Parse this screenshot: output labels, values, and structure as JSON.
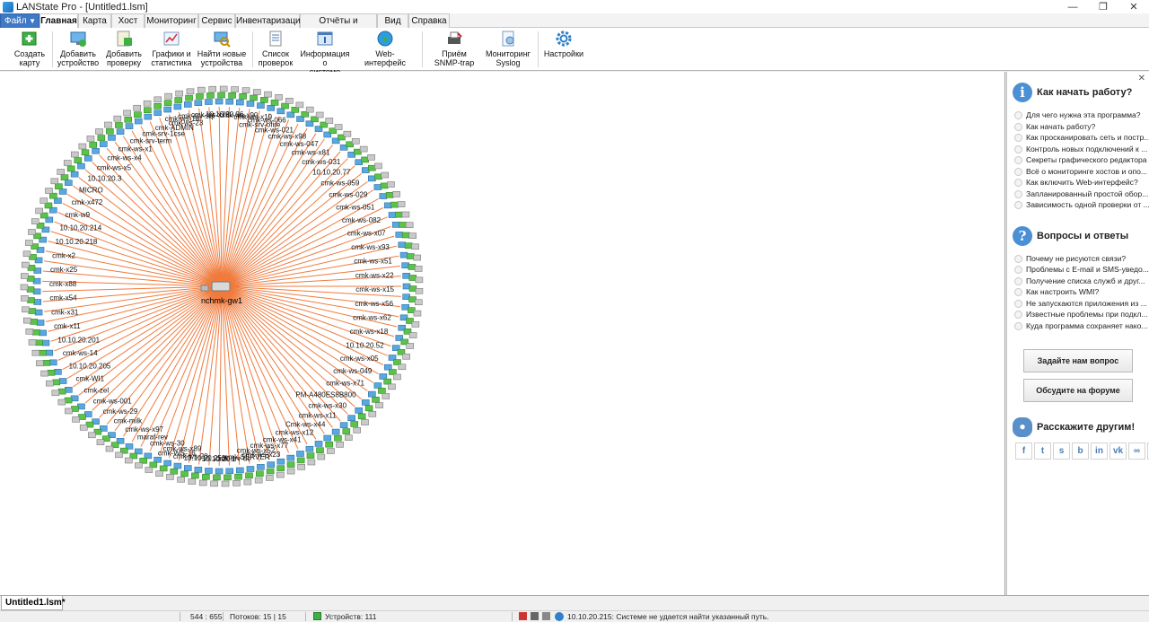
{
  "window": {
    "title": "LANState Pro - [Untitled1.lsm]"
  },
  "menu": {
    "file_label": "Файл",
    "tabs": [
      "Главная",
      "Карта",
      "Хост",
      "Мониторинг",
      "Сервис",
      "Инвентаризация",
      "Отчёты и журналы",
      "Вид",
      "Справка"
    ]
  },
  "ribbon": {
    "create_map": "Создать\nкарту",
    "add_device": "Добавить\nустройство",
    "add_check": "Добавить\nпроверку",
    "graphs": "Графики и\nстатистика",
    "find_devices": "Найти новые\nустройства",
    "check_list": "Список\nпроверок",
    "system_info": "Информация о\nсистеме",
    "web": "Web-интерфейс",
    "snmp": "Приём\nSNMP-trap",
    "syslog": "Мониторинг\nSyslog",
    "settings": "Настройки"
  },
  "map": {
    "center_label": "nchmk-gw1",
    "host_labels": [
      "cmk-ws-23",
      "cmk-ws-18",
      "cmk-srv-sql",
      "cmk-ws-x78",
      "10.10.20.96",
      "cmk-ws-x90",
      "cmk-ws-x19",
      "cmk-ws-066",
      "cmk-srv-ofire",
      "cmk-ws-021",
      "cmk-ws-x98",
      "cmk-ws-047",
      "cmk-ws-x81",
      "cmk-ws-031",
      "10.10.20.77",
      "cmk-ws-059",
      "cmk-ws-029",
      "cmk-ws-051",
      "cmk-ws-082",
      "cmk-ws-x07",
      "cmk-ws-x93",
      "cmk-ws-x51",
      "cmk-ws-x22",
      "cmk-ws-x15",
      "cmk-ws-x56",
      "cmk-ws-x62",
      "cmk-ws-x18",
      "10.10.20.52",
      "cmk-ws-x05",
      "cmk-ws-049",
      "cmk-ws-x71",
      "PM-A480ES8B800",
      "cmk-ws-x30",
      "cmk-ws-x11",
      "Cmk-ws-x44",
      "cmk-ws-x12",
      "cmk-ws-x41",
      "cmk-ws-x77",
      "cmk-ws-x52",
      "cmk-ws-x23",
      "cmk-SERVER",
      "cmk-srv-dc",
      "10.10.20.1",
      "10.10.20.253",
      "cmk-ws-20",
      "cmk-WS-16",
      "cmk-ws-x89",
      "cmk-ws-30",
      "maraf-rev",
      "cmk-ws-x97",
      "cmk-milk",
      "cmk-ws-29",
      "cmk-ws-001",
      "cmk-zel",
      "cmk-WI1",
      "10.10.20.205",
      "cmk-ws-14",
      "10.10.20.201",
      "cmk-x11",
      "cmk-x31",
      "cmk-x54",
      "cmk-x88",
      "cmk-x25",
      "cmk-x2",
      "10.10.20.218",
      "10.10.20.214",
      "cmk-w9",
      "cmk-x472",
      "MICRO",
      "10.10.20.3",
      "cmk-ws-x5",
      "cmk-ws-x4",
      "cmk-ws-x1",
      "cmk-srv-term",
      "cmk-srv-1cse",
      "cmk-ADMIN"
    ]
  },
  "help_panel": {
    "getting_started": "Как начать работу?",
    "links1": [
      "Для чего нужна эта программа?",
      "Как начать работу?",
      "Как просканировать сеть и постр...",
      "Контроль новых подключений к ...",
      "Секреты графического редактора",
      "Всё о мониторинге хостов и опо...",
      "Как включить Web-интерфейс?",
      "Запланированный простой обор...",
      "Зависимость одной проверки от ..."
    ],
    "qa": "Вопросы и ответы",
    "links2": [
      "Почему не рисуются связи?",
      "Проблемы с E-mail и SMS-уведо...",
      "Получение списка служб и друг...",
      "Как настроить WMI?",
      "Не запускаются приложения из ...",
      "Известные проблемы при подкл...",
      "Куда программа сохраняет нако..."
    ],
    "ask_button": "Задайте нам вопрос",
    "forum_button": "Обсудите на форуме",
    "share": "Расскажите другим!"
  },
  "doc_tab": "Untitled1.lsm*",
  "status": {
    "coords": "544 : 655",
    "threads": "Потоков: 15 | 15",
    "devices": "Устройств: 111",
    "message": "10.10.20.215: Системе не удается найти указанный путь."
  }
}
